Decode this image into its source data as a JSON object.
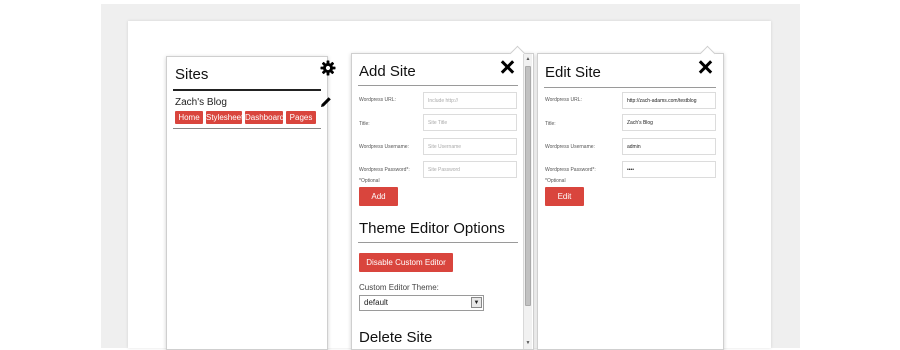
{
  "sites_panel": {
    "title": "Sites",
    "site": {
      "name": "Zach's Blog",
      "buttons": [
        "Home",
        "Stylesheet",
        "Dashboard",
        "Pages"
      ]
    }
  },
  "add_site": {
    "title": "Add Site",
    "fields": [
      {
        "label": "Wordpress URL:",
        "placeholder": "Include http://"
      },
      {
        "label": "Title:",
        "placeholder": "Site Title"
      },
      {
        "label": "Wordpress Username:",
        "placeholder": "Site Username"
      },
      {
        "label": "Wordpress Password*:",
        "placeholder": "Site Password"
      }
    ],
    "optional_note": "*Optional",
    "add_button": "Add",
    "theme_section_title": "Theme Editor Options",
    "disable_button": "Disable Custom Editor",
    "custom_theme_label": "Custom Editor Theme:",
    "custom_theme_value": "default",
    "delete_section_title": "Delete Site"
  },
  "edit_site": {
    "title": "Edit Site",
    "fields": [
      {
        "label": "Wordpress URL:",
        "value": "http://zach-adams.com/testblog"
      },
      {
        "label": "Title:",
        "value": "Zach's Blog"
      },
      {
        "label": "Wordpress Username:",
        "value": "admin"
      },
      {
        "label": "Wordpress Password*:",
        "value": "••••"
      }
    ],
    "optional_note": "*Optional",
    "edit_button": "Edit"
  },
  "colors": {
    "accent": "#d9453d"
  }
}
